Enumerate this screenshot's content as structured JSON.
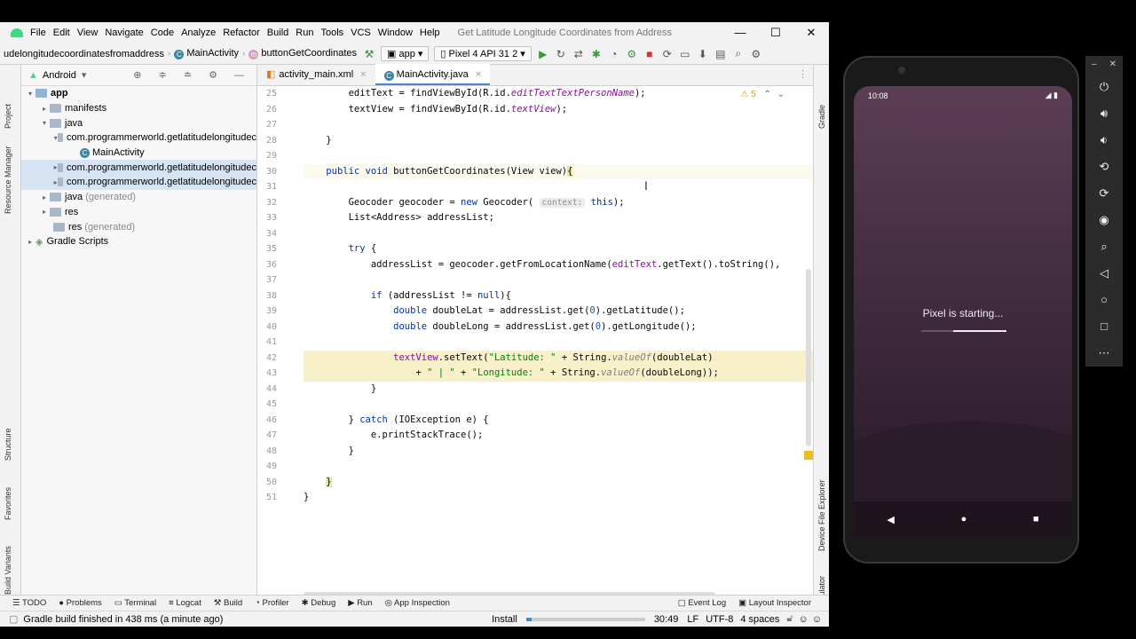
{
  "menu": {
    "items": [
      "File",
      "Edit",
      "View",
      "Navigate",
      "Code",
      "Analyze",
      "Refactor",
      "Build",
      "Run",
      "Tools",
      "VCS",
      "Window",
      "Help"
    ],
    "window_title": "Get Latitude Longitude Coordinates from Address",
    "minimize": "—",
    "maximize": "☐",
    "close": "✕"
  },
  "nav": {
    "crumb_project": "udelongitudecoordinatesfromaddress",
    "crumb_class": "MainActivity",
    "crumb_method": "buttonGetCoordinates",
    "run_config": "app",
    "device": "Pixel 4 API 31 2"
  },
  "project": {
    "view_label": "Android",
    "tree": [
      {
        "label": "app",
        "bold": true
      },
      {
        "label": "manifests"
      },
      {
        "label": "java"
      },
      {
        "label": "com.programmerworld.getlatitudelongitudec"
      },
      {
        "label": "MainActivity"
      },
      {
        "label": "com.programmerworld.getlatitudelongitudec"
      },
      {
        "label": "com.programmerworld.getlatitudelongitudec"
      },
      {
        "label": "java",
        "suffix": "(generated)"
      },
      {
        "label": "res"
      },
      {
        "label": "res",
        "suffix": "(generated)"
      },
      {
        "label": "Gradle Scripts"
      }
    ]
  },
  "left_strip": {
    "project": "Project",
    "resource_manager": "Resource Manager",
    "structure": "Structure",
    "favorites": "Favorites",
    "build_variants": "Build Variants"
  },
  "right_strip": {
    "gradle": "Gradle",
    "device_file_explorer": "Device File Explorer",
    "emulator": "Emulator"
  },
  "tabs": [
    "activity_main.xml",
    "MainActivity.java"
  ],
  "editor": {
    "warnings": "5",
    "line_numbers": [
      "25",
      "26",
      "27",
      "28",
      "29",
      "30",
      "31",
      "32",
      "33",
      "34",
      "35",
      "36",
      "37",
      "38",
      "39",
      "40",
      "41",
      "42",
      "43",
      "44",
      "45",
      "46",
      "47",
      "48",
      "49",
      "50",
      "51"
    ],
    "tokens": {
      "l25a": "        editText = findViewById(R.id.",
      "l25b": "editTextTextPersonName",
      "l25c": ");",
      "l26a": "        textView = findViewById(R.id.",
      "l26b": "textView",
      "l26c": ");",
      "l28": "    }",
      "l30a": "public void",
      "l30b": " buttonGetCoordinates(View view)",
      "l30c": "{",
      "l32a": "        Geocoder geocoder = ",
      "l32b": "new",
      "l32c": " Geocoder( ",
      "l32d": "context:",
      "l32e": "this",
      "l32f": ");",
      "l33": "        List<Address> addressList;",
      "l35a": "try",
      "l35b": " {",
      "l36a": "            addressList = geocoder.getFromLocationName(",
      "l36b": "editText",
      "l36c": ".getText().toString(),",
      "l38a": "if",
      "l38b": " (addressList != ",
      "l38c": "null",
      "l38d": "){",
      "l39a": "double",
      "l39b": " doubleLat = addressList.get(",
      "l39c": "0",
      "l39d": ").getLatitude();",
      "l40a": "double",
      "l40b": " doubleLong = addressList.get(",
      "l40c": "0",
      "l40d": ").getLongitude();",
      "l42a": "textView",
      "l42b": ".setText(",
      "l42c": "\"Latitude: \"",
      "l42d": " + String.",
      "l42e": "valueOf",
      "l42f": "(doubleLat)",
      "l43a": "+ ",
      "l43b": "\" | \"",
      "l43c": " + ",
      "l43d": "\"Longitude: \"",
      "l43e": " + String.",
      "l43f": "valueOf",
      "l43g": "(doubleLong));",
      "l44": "            }",
      "l46a": "        } ",
      "l46b": "catch",
      "l46c": " (IOException e) {",
      "l47": "            e.printStackTrace();",
      "l48": "        }",
      "l50": "}",
      "l51": "}"
    }
  },
  "bottom_tools": [
    "TODO",
    "Problems",
    "Terminal",
    "Logcat",
    "Build",
    "Profiler",
    "Debug",
    "Run",
    "App Inspection",
    "Event Log",
    "Layout Inspector"
  ],
  "status": {
    "message": "Gradle build finished in 438 ms (a minute ago)",
    "install": "Install",
    "position": "30:49",
    "line_sep": "LF",
    "encoding": "UTF-8",
    "indent": "4 spaces"
  },
  "emulator": {
    "time": "10:08",
    "boot_message": "Pixel is starting..."
  },
  "colors": {
    "keyword": "#0033b3",
    "string": "#067d17",
    "field": "#871094",
    "android_green": "#3ddc84"
  }
}
